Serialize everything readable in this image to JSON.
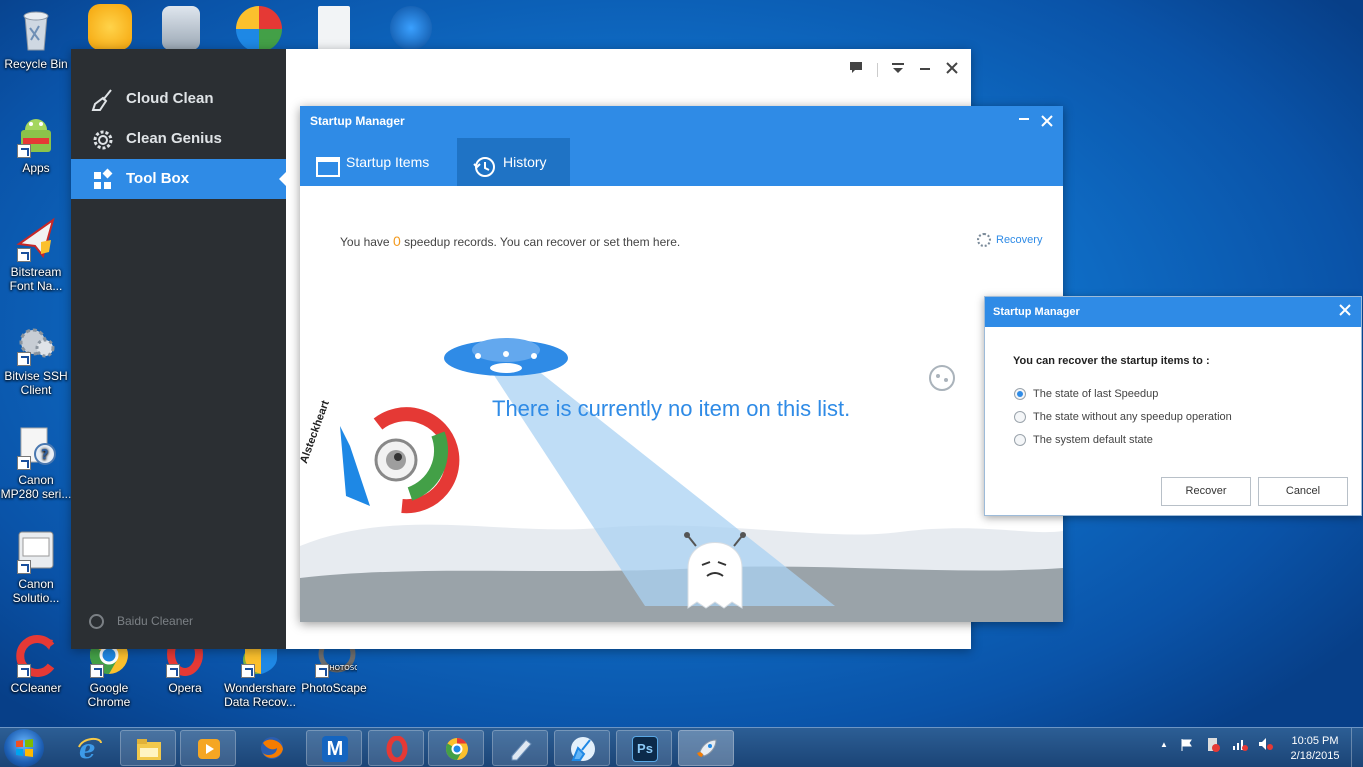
{
  "desktop": {
    "left_icons": [
      {
        "name": "recycle-bin",
        "label": "Recycle Bin"
      },
      {
        "name": "apps",
        "label": "Apps"
      },
      {
        "name": "bitstream",
        "label": "Bitstream Font Na..."
      },
      {
        "name": "bitvise",
        "label": "Bitvise SSH Client"
      },
      {
        "name": "canon-mp280",
        "label": "Canon MP280 seri..."
      },
      {
        "name": "canon-solution",
        "label": "Canon Solutio..."
      },
      {
        "name": "ccleaner",
        "label": "CCleaner"
      }
    ],
    "bottom_icons": [
      {
        "name": "google-chrome",
        "label": "Google Chrome"
      },
      {
        "name": "opera",
        "label": "Opera"
      },
      {
        "name": "wondershare",
        "label": "Wondershare Data Recov..."
      },
      {
        "name": "photoscape",
        "label": "PhotoScape"
      }
    ]
  },
  "app": {
    "nav": [
      {
        "label": "Cloud Clean",
        "icon": "broom-icon"
      },
      {
        "label": "Clean Genius",
        "icon": "gear-icon"
      },
      {
        "label": "Tool Box",
        "icon": "grid-icon",
        "active": true
      }
    ],
    "brand": "Baidu Cleaner",
    "window_buttons": [
      "chat-icon",
      "menu-icon",
      "minimize-icon",
      "close-icon"
    ]
  },
  "startup_manager": {
    "title": "Startup Manager",
    "tabs": [
      {
        "label": "Startup Items",
        "icon": "window-icon"
      },
      {
        "label": "History",
        "icon": "clock-icon",
        "active": true
      }
    ],
    "records_prefix": "You have",
    "records_count": "0",
    "records_suffix": "speedup records. You can recover or set them here.",
    "recovery_link": "Recovery",
    "empty_message": "There is currently no item on this list.",
    "watermark": "Alsteckheart"
  },
  "recover_dialog": {
    "title": "Startup Manager",
    "question": "You can recover the startup items to :",
    "options": [
      {
        "label": "The state of last Speedup",
        "selected": true
      },
      {
        "label": "The state without any speedup operation",
        "selected": false
      },
      {
        "label": "The system default state",
        "selected": false
      }
    ],
    "recover_label": "Recover",
    "cancel_label": "Cancel"
  },
  "taskbar": {
    "time": "10:05 PM",
    "date": "2/18/2015",
    "apps": [
      "explorer",
      "media-player",
      "firefox",
      "malwarebytes",
      "opera",
      "chrome",
      "notepad",
      "cleaner",
      "photoshop",
      "baidu-cleaner"
    ],
    "ps_label": "Ps",
    "m_label": "M"
  },
  "colors": {
    "accent": "#2f8be6",
    "sidebar": "#2b2f33",
    "count": "#f39a1e"
  }
}
